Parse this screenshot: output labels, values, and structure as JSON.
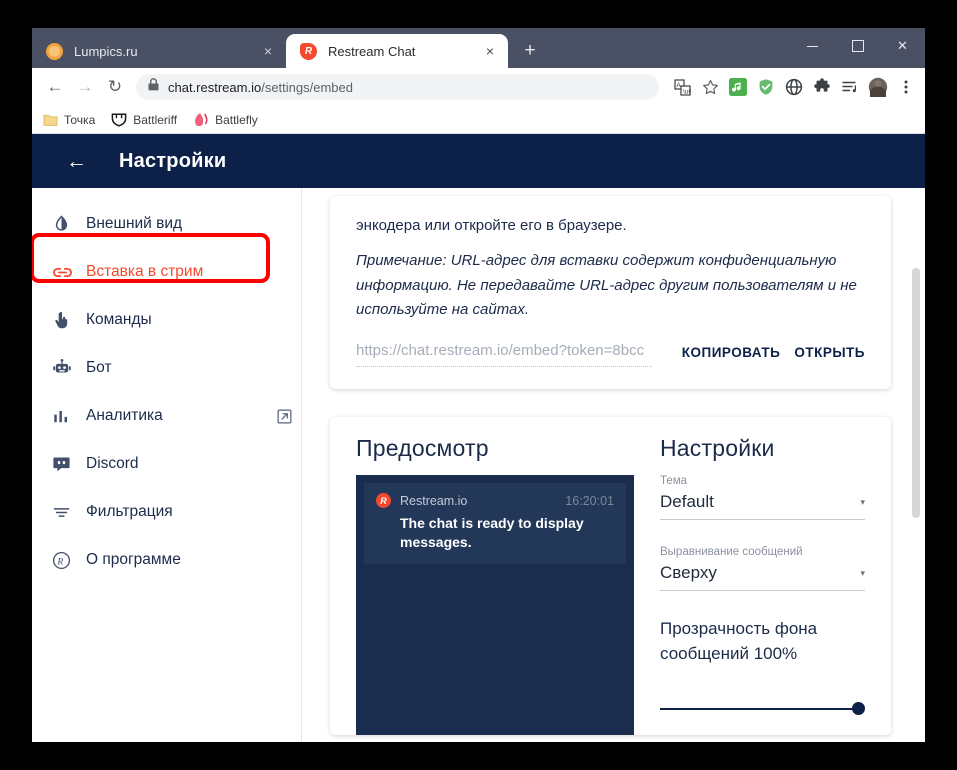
{
  "browser": {
    "tabs": [
      {
        "title": "Lumpics.ru",
        "favicon": "orange-circle-icon",
        "active": false,
        "close_label": "×"
      },
      {
        "title": "Restream Chat",
        "favicon": "restream-icon",
        "active": true,
        "close_label": "×"
      }
    ],
    "new_tab_label": "+",
    "window_controls": {
      "minimize": "—",
      "maximize": "☐",
      "close": "✕"
    },
    "nav": {
      "back": "←",
      "forward": "→",
      "reload": "↻"
    },
    "omnibox": {
      "lock_icon": "lock-icon",
      "url_host": "chat.restream.io",
      "url_path": "/settings/embed"
    },
    "toolbar_icons": [
      "translate-icon",
      "bookmark-star-icon",
      "music-extension-icon",
      "adguard-shield-icon",
      "globe-extension-icon",
      "puzzle-extensions-icon",
      "playlist-icon",
      "profile-avatar",
      "three-dot-menu-icon"
    ],
    "bookmarks": [
      {
        "label": "Точка",
        "icon": "folder-icon"
      },
      {
        "label": "Battleriff",
        "icon": "battleriff-icon"
      },
      {
        "label": "Battlefly",
        "icon": "battlefly-icon"
      }
    ]
  },
  "app": {
    "header": {
      "back_arrow": "←",
      "title": "Настройки"
    },
    "sidebar": {
      "items": [
        {
          "label": "Внешний вид",
          "icon": "contrast-icon",
          "selected": false,
          "external": false
        },
        {
          "label": "Вставка в стрим",
          "icon": "link-icon",
          "selected": true,
          "external": false
        },
        {
          "label": "Команды",
          "icon": "hand-pointer-icon",
          "selected": false,
          "external": false
        },
        {
          "label": "Бот",
          "icon": "robot-icon",
          "selected": false,
          "external": false
        },
        {
          "label": "Аналитика",
          "icon": "bar-chart-icon",
          "selected": false,
          "external": true
        },
        {
          "label": "Discord",
          "icon": "discord-icon",
          "selected": false,
          "external": false
        },
        {
          "label": "Фильтрация",
          "icon": "filter-icon",
          "selected": false,
          "external": false
        },
        {
          "label": "О программе",
          "icon": "restream-logo-icon",
          "selected": false,
          "external": false
        }
      ],
      "highlight_color": "#ff0000"
    },
    "embed_card": {
      "paragraph_top": "энкодера или откройте его в браузере.",
      "note": "Примечание: URL-адрес для вставки содержит конфиденциальную информацию. Не передавайте URL-адрес другим пользователям и не используйте на сайтах.",
      "embed_url": "https://chat.restream.io/embed?token=8bcc",
      "copy_label": "КОПИРОВАТЬ",
      "open_label": "ОТКРЫТЬ"
    },
    "preview": {
      "title": "Предосмотр",
      "message": {
        "avatar_letter": "R",
        "author": "Restream.io",
        "time": "16:20:01",
        "text": "The chat is ready to display messages."
      }
    },
    "settings": {
      "title": "Настройки",
      "theme": {
        "label": "Тема",
        "value": "Default",
        "caret": "▾"
      },
      "alignment": {
        "label": "Выравнивание сообщений",
        "value": "Сверху",
        "caret": "▾"
      },
      "opacity": {
        "label": "Прозрачность фона сообщений 100%",
        "value": 100
      }
    },
    "colors": {
      "header_navy": "#0d2048",
      "accent_orange": "#f5492e",
      "preview_bg": "#1b2d4f",
      "message_bg": "#233759"
    }
  }
}
